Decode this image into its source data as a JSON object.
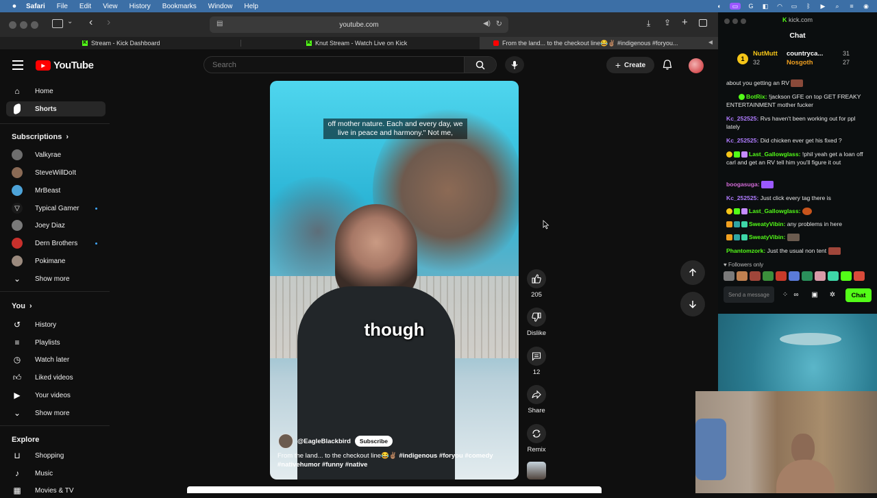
{
  "menubar": {
    "app": "Safari",
    "items": [
      "File",
      "Edit",
      "View",
      "History",
      "Bookmarks",
      "Window",
      "Help"
    ]
  },
  "browser": {
    "url": "youtube.com",
    "tabs": [
      {
        "label": "Stream - Kick Dashboard"
      },
      {
        "label": "Knut Stream - Watch Live on Kick"
      },
      {
        "label": "From the land... to the checkout line😂✌🏽 #indigenous #foryou..."
      }
    ]
  },
  "youtube": {
    "logo_text": "YouTube",
    "search_placeholder": "Search",
    "create_label": "Create",
    "sidebar": {
      "main": [
        {
          "label": "Home",
          "icon": "home-icon"
        },
        {
          "label": "Shorts",
          "icon": "shorts-icon",
          "active": true
        }
      ],
      "subscriptions_heading": "Subscriptions",
      "subscriptions": [
        {
          "label": "Valkyrae",
          "color": "#6e6e6e",
          "dot": false
        },
        {
          "label": "SteveWillDoIt",
          "color": "#8a6a55",
          "dot": false
        },
        {
          "label": "MrBeast",
          "color": "#4da3d8",
          "dot": false
        },
        {
          "label": "Typical Gamer",
          "color": "#1a1a1a",
          "dot": true
        },
        {
          "label": "Joey Diaz",
          "color": "#7a7a7a",
          "dot": false
        },
        {
          "label": "Dern Brothers",
          "color": "#c8302c",
          "dot": true
        },
        {
          "label": "Pokimane",
          "color": "#9b8a7e",
          "dot": false
        }
      ],
      "show_more_1": "Show more",
      "you_heading": "You",
      "you_items": [
        {
          "label": "History",
          "icon": "history-icon"
        },
        {
          "label": "Playlists",
          "icon": "playlists-icon"
        },
        {
          "label": "Watch later",
          "icon": "watch-later-icon"
        },
        {
          "label": "Liked videos",
          "icon": "liked-videos-icon"
        },
        {
          "label": "Your videos",
          "icon": "your-videos-icon"
        }
      ],
      "show_more_2": "Show more",
      "explore_heading": "Explore",
      "explore_items": [
        {
          "label": "Shopping",
          "icon": "shopping-icon"
        },
        {
          "label": "Music",
          "icon": "music-icon"
        },
        {
          "label": "Movies & TV",
          "icon": "movies-icon"
        }
      ]
    },
    "short": {
      "caption_top": "off mother nature. Each and every day, we live in peace and harmony.\" Not me,",
      "caption_big": "though",
      "channel": "@EagleBlackbird",
      "subscribe_label": "Subscribe",
      "title_text": "From the land... to the checkout line😂✌🏽 ",
      "title_tags": "#indigenous #foryou #comedy #nativehumor #funny #native",
      "likes": "205",
      "dislike_label": "Dislike",
      "comments": "12",
      "share_label": "Share",
      "remix_label": "Remix"
    }
  },
  "kick": {
    "url": "kick.com",
    "title": "Chat",
    "gifters": [
      {
        "name": "NutMutt",
        "count": "32",
        "rank": "1"
      },
      {
        "name": "countryca...",
        "count": "31"
      },
      {
        "name": "Nosgoth",
        "count": "27"
      }
    ],
    "messages": [
      {
        "user": "",
        "text": "about you getting an RV",
        "color": "#e6e6e6"
      },
      {
        "user": "BotRix:",
        "text": " !jackson GFE on top GET FREAKY ENTERTAINMENT mother fucker",
        "color": "#53fc18"
      },
      {
        "user": "Kc_252525:",
        "text": " Rvs haven't been working out for ppl lately",
        "color": "#b07cff"
      },
      {
        "user": "Kc_252525:",
        "text": " Did chicken ever get his fixed ?",
        "color": "#b07cff"
      },
      {
        "user": "Last_Gallowglass:",
        "text": " !phil yeah get a loan off carl and get an RV tell him you'll figure it out",
        "color": "#53fc18"
      },
      {
        "user": "boogasuga:",
        "text": "",
        "color": "#d36bd8"
      },
      {
        "user": "Kc_252525:",
        "text": " Just click every tag there is",
        "color": "#b07cff"
      },
      {
        "user": "Last_Gallowglass:",
        "text": "",
        "color": "#53fc18"
      },
      {
        "user": "SweatyVibin:",
        "text": " any problems in here",
        "color": "#53fc18"
      },
      {
        "user": "SweatyVibin:",
        "text": "",
        "color": "#53fc18"
      },
      {
        "user": "Phantomzork:",
        "text": " Just the usual non tent",
        "color": "#53fc18"
      }
    ],
    "followers_only": "Followers only",
    "input_placeholder": "Send a message",
    "chat_button": "Chat"
  },
  "colors": {
    "youtube_red": "#ff0000",
    "kick_green": "#53fc18",
    "link_blue": "#3ea6ff"
  }
}
